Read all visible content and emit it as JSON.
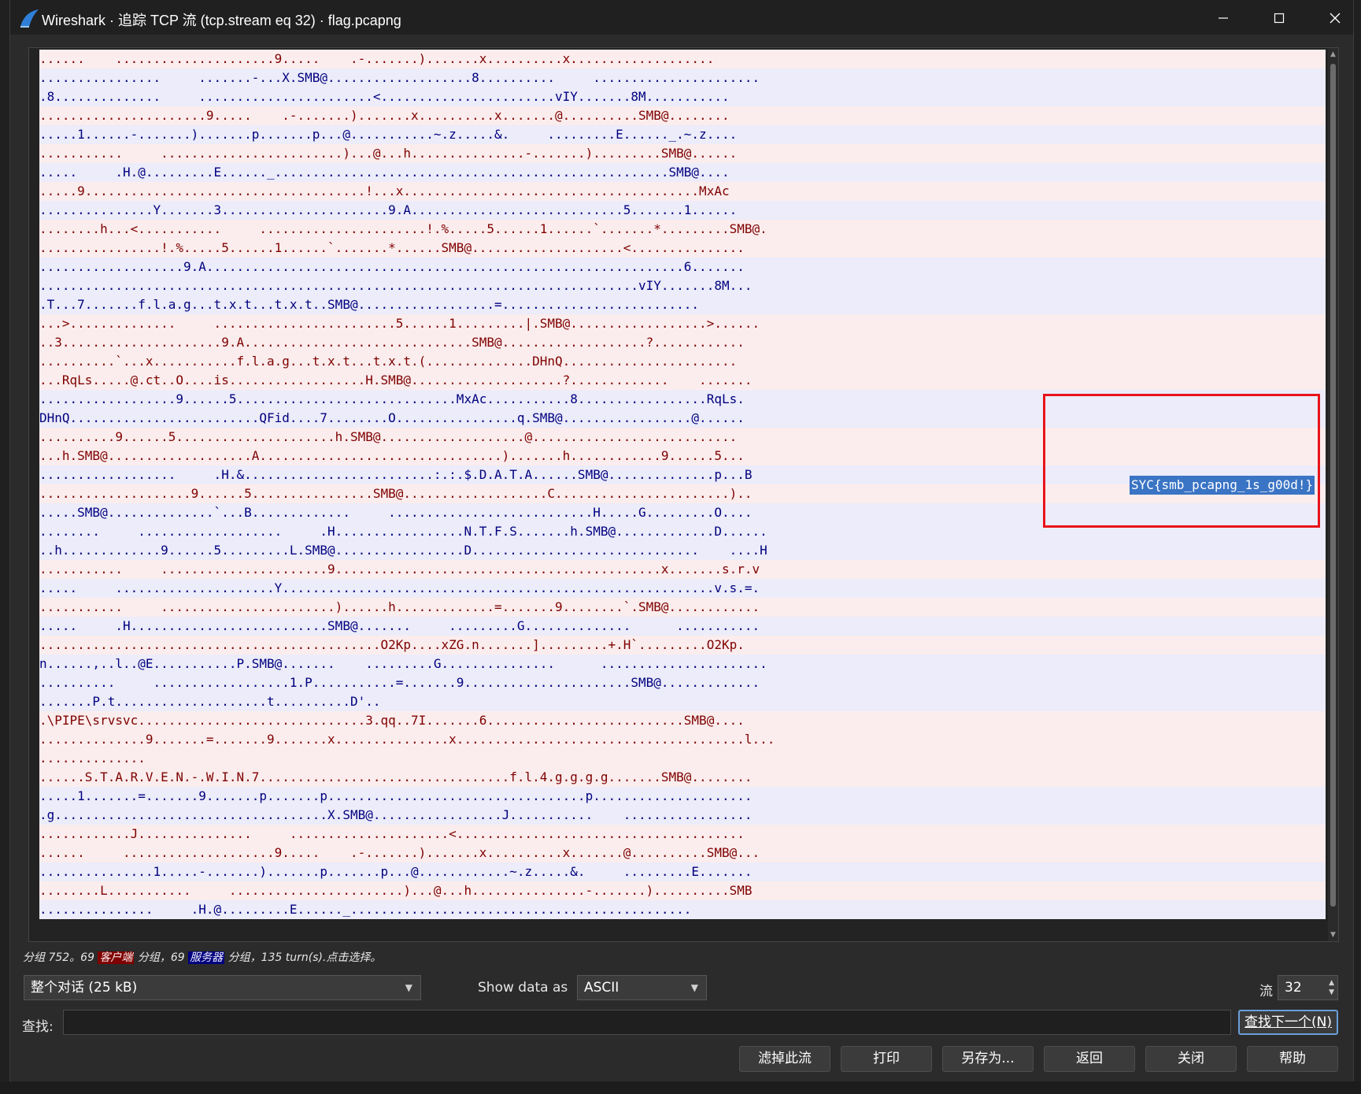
{
  "window": {
    "title": "Wireshark · 追踪 TCP 流 (tcp.stream eq 32) · flag.pcapng",
    "minimize_icon": "minimize-icon",
    "maximize_icon": "maximize-icon",
    "close_icon": "close-icon"
  },
  "colors": {
    "client_bg": "#fbeded",
    "client_fg": "#7f0000",
    "server_bg": "#ececfa",
    "server_fg": "#00007f",
    "highlight": "#3a74c4",
    "annotation": "#e8141a"
  },
  "stream": {
    "lines": [
      {
        "side": "c",
        "text": "......    .....................9.....    .-.......).......x..........x..................."
      },
      {
        "side": "s",
        "text": "................     .......-...X.SMB@...................8..........     ......................"
      },
      {
        "side": "s",
        "text": ".8..............     .......................<.......................vIY.......8M..........."
      },
      {
        "side": "c",
        "text": "......................9.....    .-.......).......x..........x.......@..........SMB@........"
      },
      {
        "side": "s",
        "text": ".....1......-.......).......p.......p...@...........~.z.....&.     .........E......_.~.z...."
      },
      {
        "side": "c",
        "text": "...........     ........................)...@...h...............-.......).........SMB@......"
      },
      {
        "side": "s",
        "text": ".....     .H.@.........E......_....................................................SMB@...."
      },
      {
        "side": "c",
        "text": ".....9.....................................!...x.......................................MxAc"
      },
      {
        "side": "s",
        "text": "...............Y.......3......................9.A............................5.......1......"
      },
      {
        "side": "c",
        "text": "........h...<...........     ......................!.%.....5......1......`.......*.........SMB@."
      },
      {
        "side": "c",
        "text": "................!.%.....5......1......`.......*......SMB@....................<..............."
      },
      {
        "side": "s",
        "text": "...................9.A...............................................................6......."
      },
      {
        "side": "s",
        "text": "...............................................................................vIY.......8M..."
      },
      {
        "side": "s",
        "text": ".T...7.......f.l.a.g...t.x.t...t.x.t..SMB@..................=.........................."
      },
      {
        "side": "c",
        "text": "...>..............     ........................5......1.........|.SMB@..................>......"
      },
      {
        "side": "c",
        "text": "..3.....................9.A..............................SMB@...................?............"
      },
      {
        "side": "c",
        "text": "..........`...x...........f.l.a.g...t.x.t...t.x.t.(..............DHnQ......................."
      },
      {
        "side": "c",
        "text": "...RqLs.....@.ct..O....is..................H.SMB@....................?.............    ......."
      },
      {
        "side": "s",
        "text": "..................9......5.............................MxAc...........8.................RqLs."
      },
      {
        "side": "s",
        "text": "DHnQ.........................QFid....7........O................q.SMB@.................@......"
      },
      {
        "side": "c",
        "text": "..........9......5.....................h.SMB@...................@..........................."
      },
      {
        "side": "c",
        "text": "...h.SMB@...................A................................).......h............9......5..."
      },
      {
        "side": "s",
        "text": "..................     .H.&.........................:.:.$.D.A.T.A......SMB@..............p...B"
      },
      {
        "side": "c",
        "text": "....................9......5................SMB@...................C.......................).."
      },
      {
        "side": "s",
        "text": ".....SMB@..............`...B.............     ...........................H.....G.........O...."
      },
      {
        "side": "s",
        "text": "........     ...................     .H.................N.T.F.S.......h.SMB@.............D......"
      },
      {
        "side": "s",
        "text": "..h.............9......5.........L.SMB@.................D..............................    ....H"
      },
      {
        "side": "c",
        "text": "...........     ......................9...........................................x.......s.r.v"
      },
      {
        "side": "s",
        "text": ".....     .....................Y.........................................................v.s.=."
      },
      {
        "side": "c",
        "text": "...........     .......................)......h.............=.......9........`.SMB@............"
      },
      {
        "side": "s",
        "text": ".....     .H..........................SMB@.......     .........G..............      ..........."
      },
      {
        "side": "c",
        "text": ".............................................O2Kp....xZG.n.......].........+.H`.........O2Kp."
      },
      {
        "side": "s",
        "text": "n......,..l..@E...........P.SMB@.......    .........G...............      ......................"
      },
      {
        "side": "s",
        "text": "..........     ..................1.P...........=.......9......................SMB@............."
      },
      {
        "side": "s",
        "text": ".......P.t....................t..........D'.."
      },
      {
        "side": "c",
        "text": ".\\PIPE\\srvsvc..............................3.qq..7I.......6..........................SMB@...."
      },
      {
        "side": "c",
        "text": "..............9.......=.......9.......x...............x......................................l..."
      },
      {
        "side": "c",
        "text": ".............."
      },
      {
        "side": "c",
        "text": "......S.T.A.R.V.E.N.-.W.I.N.7.................................f.l.4.g.g.g.g.......SMB@........"
      },
      {
        "side": "s",
        "text": ".....1.......=.......9.......p.......p..................................p....................."
      },
      {
        "side": "s",
        "text": ".g....................................X.SMB@.................J...........    ................."
      },
      {
        "side": "c",
        "text": "............J...............     .....................<......................................"
      },
      {
        "side": "c",
        "text": "......     ....................9.....    .-.......).......x..........x.......@..........SMB@..."
      },
      {
        "side": "s",
        "text": "...............1.....-.......).......p.......p...@............~.z.....&.     .........E......."
      },
      {
        "side": "c",
        "text": "........L...........     .......................)...@...h...............-.......)..........SMB"
      },
      {
        "side": "s",
        "text": "...............     .H.@.........E......_............................................."
      }
    ],
    "flag_text": "SYC{smb_pcapng_1s_g00d!}"
  },
  "summary": {
    "prefix": "分组 752。69 ",
    "client_tag": "客户端",
    "middle": " 分组，69 ",
    "server_tag": "服务器",
    "suffix": " 分组，135 turn(s).点击选择。"
  },
  "controls": {
    "conversation_value": "整个对话 (25 kB)",
    "show_as_label": "Show data as",
    "show_as_value": "ASCII",
    "stream_label": "流",
    "stream_value": "32",
    "find_label": "查找:",
    "find_value": "",
    "find_next": "查找下一个(N)"
  },
  "buttons": {
    "filter_out": "滤掉此流",
    "print": "打印",
    "save_as": "另存为...",
    "back": "返回",
    "close": "关闭",
    "help": "帮助"
  }
}
